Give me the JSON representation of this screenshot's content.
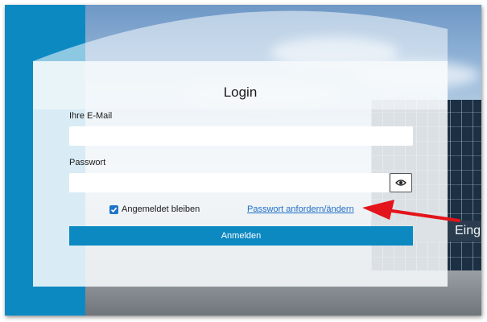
{
  "login": {
    "title": "Login",
    "email_label": "Ihre E-Mail",
    "email_value": "",
    "password_label": "Passwort",
    "password_value": "",
    "remember_label": "Angemeldet bleiben",
    "remember_checked": true,
    "reset_link": "Passwort anfordern/ändern",
    "submit_label": "Anmelden",
    "show_password_icon": "eye-icon"
  },
  "background": {
    "building_sign": "Eing"
  },
  "colors": {
    "accent": "#0d89c2",
    "link": "#1f6fc9",
    "annotation_arrow": "#e3141b"
  }
}
